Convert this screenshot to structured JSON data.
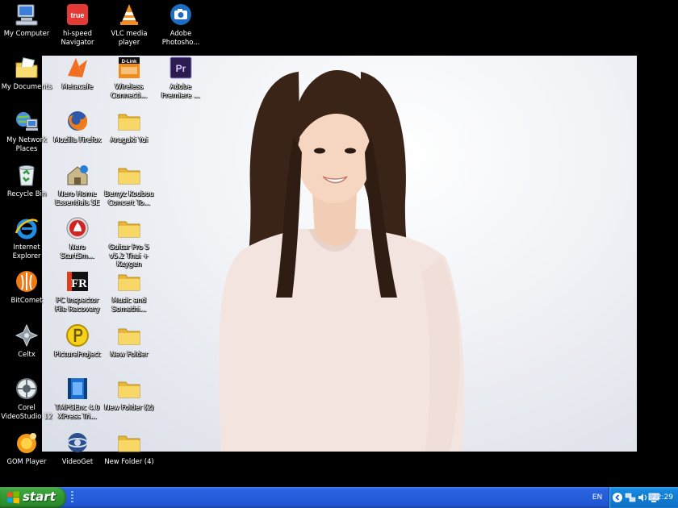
{
  "desktop": {
    "icons": [
      {
        "name": "My Computer",
        "glyph": "computer-icon"
      },
      {
        "name": "hi-speed Navigator",
        "glyph": "true-logo-icon",
        "text": "true"
      },
      {
        "name": "VLC media player",
        "glyph": "vlc-cone-icon"
      },
      {
        "name": "Adobe Photosho...",
        "glyph": "camera-icon"
      },
      {
        "name": "My Documents",
        "glyph": "documents-folder-icon"
      },
      {
        "name": "Metacafe",
        "glyph": "metacafe-icon"
      },
      {
        "name": "Wireless Connecti...",
        "glyph": "dlink-icon",
        "text": "D-Link"
      },
      {
        "name": "Adobe Premiere ...",
        "glyph": "premiere-icon",
        "text": "Pr"
      },
      {
        "name": "My Network Places",
        "glyph": "network-icon"
      },
      {
        "name": "Mozilla Firefox",
        "glyph": "firefox-icon"
      },
      {
        "name": "Aragaki Yui",
        "glyph": "folder-icon"
      },
      {
        "name": "Recycle Bin",
        "glyph": "recycle-bin-icon"
      },
      {
        "name": "Nero Home Essentials SE",
        "glyph": "nero-home-icon"
      },
      {
        "name": "Berryz Koubou Concert To...",
        "glyph": "folder-icon"
      },
      {
        "name": "Internet Explorer",
        "glyph": "ie-icon"
      },
      {
        "name": "Nero StartSm...",
        "glyph": "nero-icon"
      },
      {
        "name": "Guitar Pro 5 v5.2 Thai + Keygen",
        "glyph": "folder-icon"
      },
      {
        "name": "BitComet",
        "glyph": "bitcomet-icon"
      },
      {
        "name": "PC Inspector File Recovery",
        "glyph": "fr-icon",
        "text": "FR"
      },
      {
        "name": "Music and Somethi...",
        "glyph": "folder-icon"
      },
      {
        "name": "Celtx",
        "glyph": "celtx-icon"
      },
      {
        "name": "PictureProject",
        "glyph": "pictureproject-icon"
      },
      {
        "name": "New Folder",
        "glyph": "folder-icon"
      },
      {
        "name": "Corel VideoStudio 12",
        "glyph": "corel-icon"
      },
      {
        "name": "TMPGEnc 4.0 XPress Tri...",
        "glyph": "film-icon"
      },
      {
        "name": "New Folder (2)",
        "glyph": "folder-icon"
      },
      {
        "name": "GOM Player",
        "glyph": "gom-icon"
      },
      {
        "name": "VideoGet",
        "glyph": "videoget-icon"
      },
      {
        "name": "New Folder (4)",
        "glyph": "folder-icon"
      }
    ]
  },
  "taskbar": {
    "start_label": "start",
    "language": "EN",
    "clock": "22:29",
    "tray_icons": [
      "chevron-left-icon",
      "network-tray-icon",
      "volume-tray-icon",
      "monitor-tray-icon"
    ]
  },
  "colors": {
    "taskbar_blue": "#245edb",
    "start_green": "#3ca43c",
    "tray_blue": "#0f7ad2",
    "folder_yellow": "#f5cf52"
  }
}
